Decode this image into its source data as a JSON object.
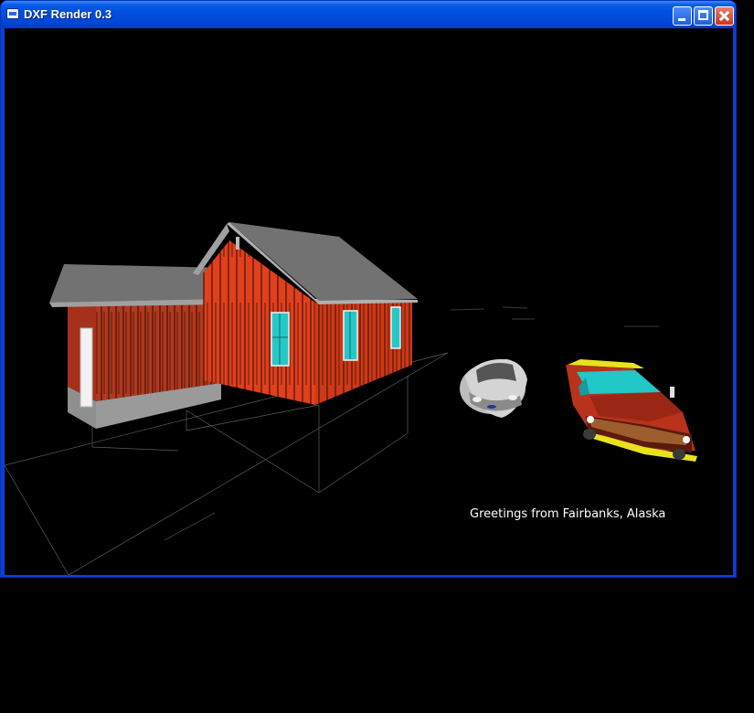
{
  "window": {
    "title": "DXF Render 0.3",
    "controls": {
      "minimize": "minimize-icon",
      "maximize": "maximize-icon",
      "close": "close-icon"
    }
  },
  "viewport": {
    "caption": "Greetings from Fairbanks, Alaska",
    "background_color": "#000000"
  },
  "colors": {
    "title_bar": "#0050e0",
    "house_wall": "#e0401c",
    "house_wall_shadow": "#b3381e",
    "roof": "#6f6f6f",
    "window_glass": "#29c9c9",
    "car_silver": "#c9c9c9",
    "truck_red": "#b8321c",
    "truck_yellow": "#e8e21e"
  }
}
